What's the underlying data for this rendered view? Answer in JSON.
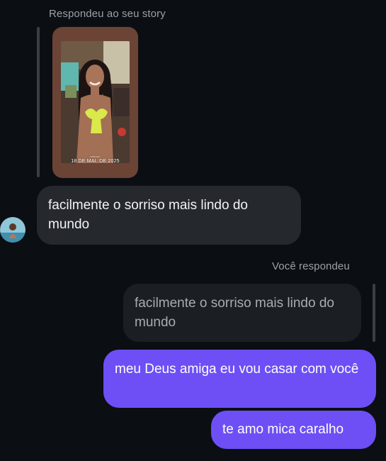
{
  "thread": {
    "story_reply_label": "Respondeu ao seu story",
    "story_date_sticker_small": "sábado",
    "story_date_sticker": "18 DE MAI. DE 2025",
    "incoming_message": "facilmente o sorriso mais lindo do mundo",
    "you_replied_label": "Você respondeu",
    "quoted_message": "facilmente o sorriso mais lindo do mundo",
    "outgoing_messages": [
      "meu Deus amiga eu vou casar com você",
      "te amo mica caralho"
    ]
  },
  "colors": {
    "background": "#0b0e12",
    "incoming_bubble": "#25282d",
    "quoted_bubble": "#1b1e22",
    "outgoing_bubble": "#6d4ff5",
    "meta_text": "#9aa1a9",
    "story_frame": "#6b4436"
  }
}
